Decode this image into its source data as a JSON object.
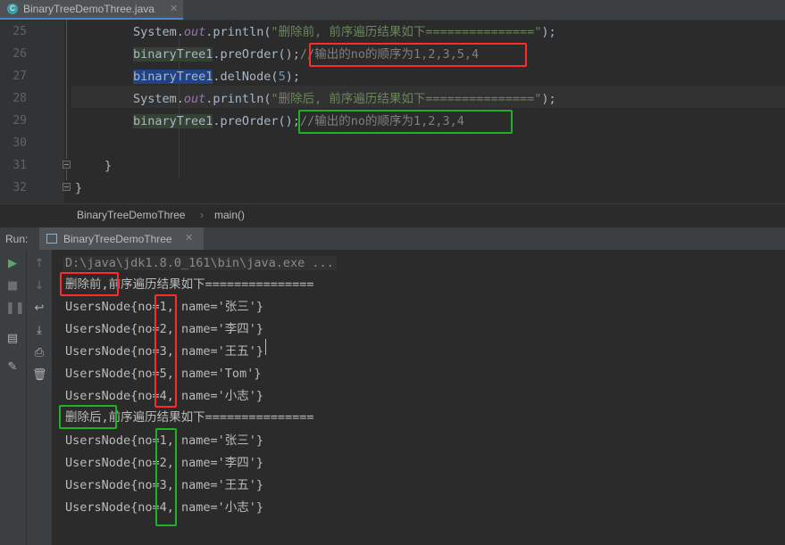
{
  "editor_tab": {
    "filename": "BinaryTreeDemoThree.java",
    "icon": "java-class-icon"
  },
  "line_numbers": [
    "25",
    "26",
    "27",
    "28",
    "29",
    "30",
    "31",
    "32"
  ],
  "code": {
    "l25_a": "System.",
    "l25_b": "out",
    "l25_c": ".println(",
    "l25_d": "\"删除前, 前序遍历结果如下===============\"",
    "l25_e": ");",
    "l26_a": "binaryTree1",
    "l26_b": ".preOrder();",
    "l26_c": "//输出的no的顺序为1,2,3,5,4",
    "l27_a": "binaryTree1",
    "l27_b": ".delNode(",
    "l27_c": "5",
    "l27_d": ");",
    "l28_a": "System.",
    "l28_b": "out",
    "l28_c": ".println(",
    "l28_d": "\"删除后, 前序遍历结果如下===============\"",
    "l28_e": ");",
    "l29_a": "binaryTree1",
    "l29_b": ".preOrder();",
    "l29_c": "//输出的no的顺序为1,2,3,4",
    "l31": "}",
    "l32": "}"
  },
  "breadcrumb": {
    "class_name": "BinaryTreeDemoThree",
    "separator": "›",
    "method": "main()"
  },
  "run": {
    "label": "Run:",
    "tab": "BinaryTreeDemoThree"
  },
  "console": {
    "path": "D:\\java\\jdk1.8.0_161\\bin\\java.exe ...",
    "before_prefix": "删除前,",
    "before_rest": "前序遍历结果如下===============",
    "before_lines": [
      "UsersNode{no=1, name='张三'}",
      "UsersNode{no=2, name='李四'}",
      "UsersNode{no=3, name='王五'}",
      "UsersNode{no=5, name='Tom'}",
      "UsersNode{no=4, name='小志'}"
    ],
    "after_prefix": "删除后,",
    "after_rest": "前序遍历结果如下===============",
    "after_lines": [
      "UsersNode{no=1, name='张三'}",
      "UsersNode{no=2, name='李四'}",
      "UsersNode{no=3, name='王五'}",
      "UsersNode{no=4, name='小志'}"
    ]
  },
  "colors": {
    "annotation_red": "#ff2a2a",
    "annotation_green": "#20b025",
    "accent_blue": "#4a88c7"
  }
}
